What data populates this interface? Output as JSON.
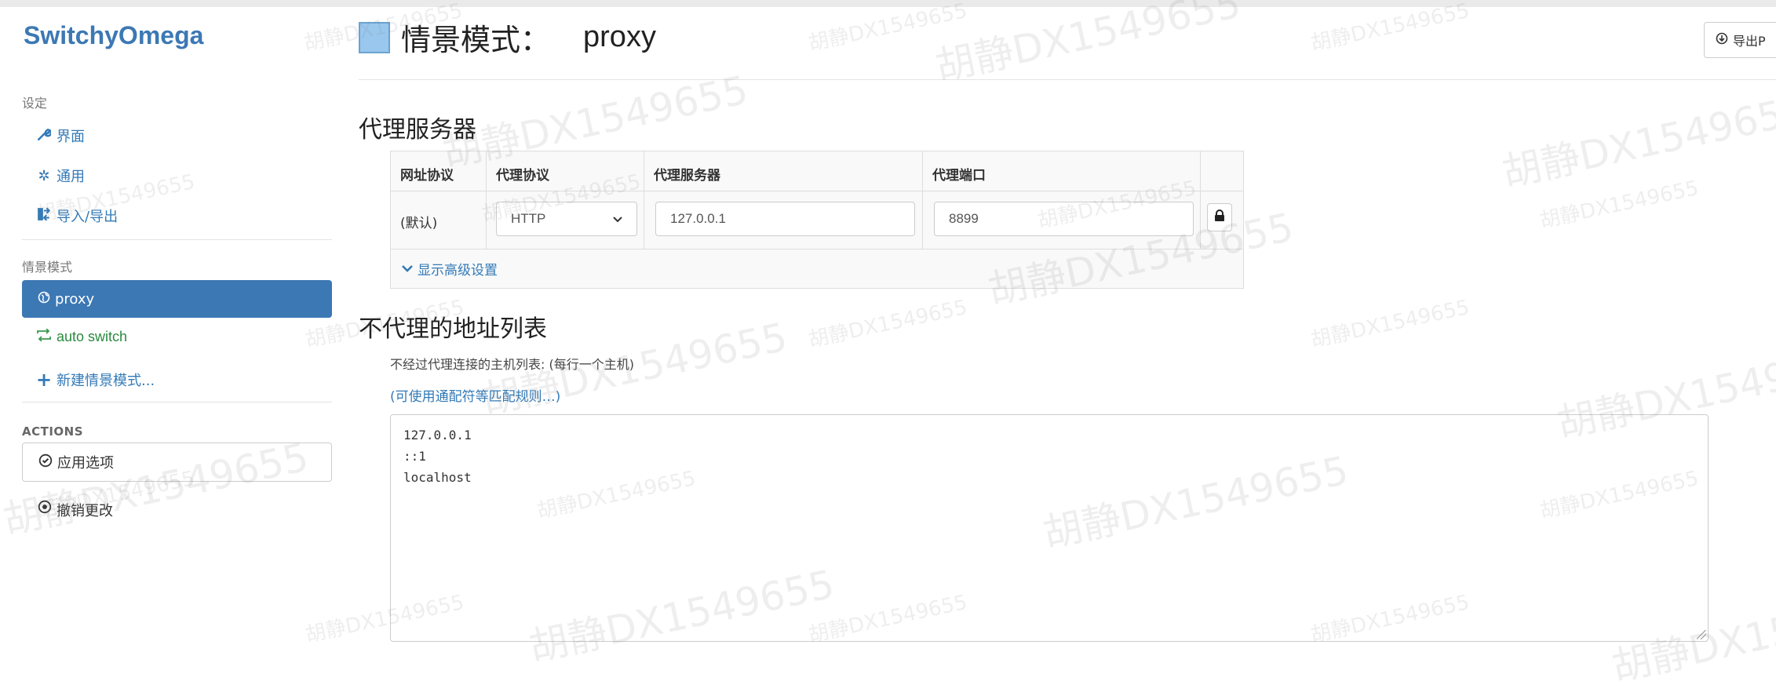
{
  "sidebar": {
    "brand": "SwitchyOmega",
    "settings_header": "设定",
    "settings_items": [
      {
        "icon": "wrench-icon",
        "label": "界面"
      },
      {
        "icon": "gear-icon",
        "label": "通用"
      },
      {
        "icon": "import-export-icon",
        "label": "导入/导出"
      }
    ],
    "profiles_header": "情景模式",
    "profiles": [
      {
        "icon": "globe-icon",
        "label": "proxy",
        "active": true
      },
      {
        "icon": "switch-arrows-icon",
        "label": "auto switch"
      },
      {
        "icon": "plus-icon",
        "label": "新建情景模式..."
      }
    ],
    "actions_header": "ACTIONS",
    "apply_label": "应用选项",
    "revert_label": "撤销更改"
  },
  "header": {
    "title_label": "情景模式：",
    "profile_name": "proxy",
    "export_label": "导出P",
    "swatch_color": "#99c7ee"
  },
  "proxy_servers": {
    "heading": "代理服务器",
    "columns": [
      "网址协议",
      "代理协议",
      "代理服务器",
      "代理端口"
    ],
    "row": {
      "scheme": "(默认)",
      "protocol": "HTTP",
      "server": "127.0.0.1",
      "port": "8899"
    },
    "advanced_link": "显示高级设置"
  },
  "bypass": {
    "heading": "不代理的地址列表",
    "description": "不经过代理连接的主机列表: (每行一个主机)",
    "wildcard_link": "(可使用通配符等匹配规则…)",
    "list_text": "127.0.0.1\n::1\nlocalhost"
  },
  "watermark": "胡静DX1549655",
  "colors": {
    "accent": "#3c78b4",
    "link": "#337ab7"
  }
}
